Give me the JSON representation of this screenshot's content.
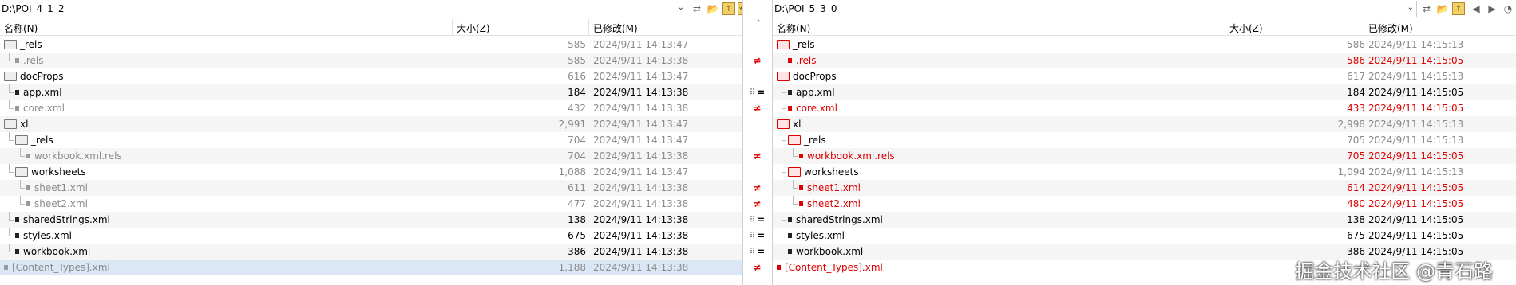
{
  "left": {
    "path": "D:\\POI_4_1_2",
    "columns": {
      "name": "名称(N)",
      "size": "大小(Z)",
      "modified": "已修改(M)"
    },
    "rows": [
      {
        "name": "_rels",
        "kind": "folder",
        "size": "585",
        "date": "2024/9/11 14:13:47",
        "state": "normal-grey-size",
        "indent": 0
      },
      {
        "name": ".rels",
        "kind": "file",
        "size": "585",
        "date": "2024/9/11 14:13:38",
        "state": "grey",
        "indent": 1
      },
      {
        "name": "docProps",
        "kind": "folder",
        "size": "616",
        "date": "2024/9/11 14:13:47",
        "state": "normal-grey-size",
        "indent": 0
      },
      {
        "name": "app.xml",
        "kind": "file",
        "size": "184",
        "date": "2024/9/11 14:13:38",
        "state": "black",
        "indent": 1
      },
      {
        "name": "core.xml",
        "kind": "file",
        "size": "432",
        "date": "2024/9/11 14:13:38",
        "state": "grey",
        "indent": 1
      },
      {
        "name": "xl",
        "kind": "folder",
        "size": "2,991",
        "date": "2024/9/11 14:13:47",
        "state": "normal-grey-size",
        "indent": 0
      },
      {
        "name": "_rels",
        "kind": "folder",
        "size": "704",
        "date": "2024/9/11 14:13:47",
        "state": "normal-grey-size",
        "indent": 1
      },
      {
        "name": "workbook.xml.rels",
        "kind": "file",
        "size": "704",
        "date": "2024/9/11 14:13:38",
        "state": "grey",
        "indent": 2
      },
      {
        "name": "worksheets",
        "kind": "folder",
        "size": "1,088",
        "date": "2024/9/11 14:13:47",
        "state": "normal-grey-size",
        "indent": 1
      },
      {
        "name": "sheet1.xml",
        "kind": "file",
        "size": "611",
        "date": "2024/9/11 14:13:38",
        "state": "grey",
        "indent": 2
      },
      {
        "name": "sheet2.xml",
        "kind": "file",
        "size": "477",
        "date": "2024/9/11 14:13:38",
        "state": "grey",
        "indent": 2
      },
      {
        "name": "sharedStrings.xml",
        "kind": "file",
        "size": "138",
        "date": "2024/9/11 14:13:38",
        "state": "black",
        "indent": 1
      },
      {
        "name": "styles.xml",
        "kind": "file",
        "size": "675",
        "date": "2024/9/11 14:13:38",
        "state": "black",
        "indent": 1
      },
      {
        "name": "workbook.xml",
        "kind": "file",
        "size": "386",
        "date": "2024/9/11 14:13:38",
        "state": "black",
        "indent": 1
      },
      {
        "name": "[Content_Types].xml",
        "kind": "file",
        "size": "1,188",
        "date": "2024/9/11 14:13:38",
        "state": "grey",
        "indent": 0
      }
    ]
  },
  "right": {
    "path": "D:\\POI_5_3_0",
    "columns": {
      "name": "名称(N)",
      "size": "大小(Z)",
      "modified": "已修改(M)"
    },
    "rows": [
      {
        "name": "_rels",
        "kind": "folder-red",
        "size": "586",
        "date": "2024/9/11 14:15:13",
        "state": "normal-grey-size",
        "indent": 0
      },
      {
        "name": ".rels",
        "kind": "file-red",
        "size": "586",
        "date": "2024/9/11 14:15:05",
        "state": "red",
        "indent": 1
      },
      {
        "name": "docProps",
        "kind": "folder-red",
        "size": "617",
        "date": "2024/9/11 14:15:13",
        "state": "normal-grey-size",
        "indent": 0
      },
      {
        "name": "app.xml",
        "kind": "file",
        "size": "184",
        "date": "2024/9/11 14:15:05",
        "state": "black",
        "indent": 1
      },
      {
        "name": "core.xml",
        "kind": "file-red",
        "size": "433",
        "date": "2024/9/11 14:15:05",
        "state": "red",
        "indent": 1
      },
      {
        "name": "xl",
        "kind": "folder-red",
        "size": "2,998",
        "date": "2024/9/11 14:15:13",
        "state": "normal-grey-size",
        "indent": 0
      },
      {
        "name": "_rels",
        "kind": "folder-red",
        "size": "705",
        "date": "2024/9/11 14:15:13",
        "state": "normal-grey-size",
        "indent": 1
      },
      {
        "name": "workbook.xml.rels",
        "kind": "file-red",
        "size": "705",
        "date": "2024/9/11 14:15:05",
        "state": "red",
        "indent": 2
      },
      {
        "name": "worksheets",
        "kind": "folder-red",
        "size": "1,094",
        "date": "2024/9/11 14:15:13",
        "state": "normal-grey-size",
        "indent": 1
      },
      {
        "name": "sheet1.xml",
        "kind": "file-red",
        "size": "614",
        "date": "2024/9/11 14:15:05",
        "state": "red",
        "indent": 2
      },
      {
        "name": "sheet2.xml",
        "kind": "file-red",
        "size": "480",
        "date": "2024/9/11 14:15:05",
        "state": "red",
        "indent": 2
      },
      {
        "name": "sharedStrings.xml",
        "kind": "file",
        "size": "138",
        "date": "2024/9/11 14:15:05",
        "state": "black",
        "indent": 1
      },
      {
        "name": "styles.xml",
        "kind": "file",
        "size": "675",
        "date": "2024/9/11 14:15:05",
        "state": "black",
        "indent": 1
      },
      {
        "name": "workbook.xml",
        "kind": "file",
        "size": "386",
        "date": "2024/9/11 14:15:05",
        "state": "black",
        "indent": 1
      },
      {
        "name": "[Content_Types].xml",
        "kind": "file-red",
        "size": "",
        "date": "",
        "state": "red",
        "indent": 0
      }
    ]
  },
  "markers": [
    "",
    "≠",
    "",
    "=",
    "≠",
    "",
    "",
    "≠",
    "",
    "≠",
    "≠",
    "=",
    "=",
    "=",
    "≠"
  ],
  "watermark": "掘金技术社区 @青石路",
  "colors": {
    "diff": "#e00000",
    "muted": "#8a8a8a",
    "selected": "#dbe7f5",
    "shade": "#f5f5f5"
  }
}
